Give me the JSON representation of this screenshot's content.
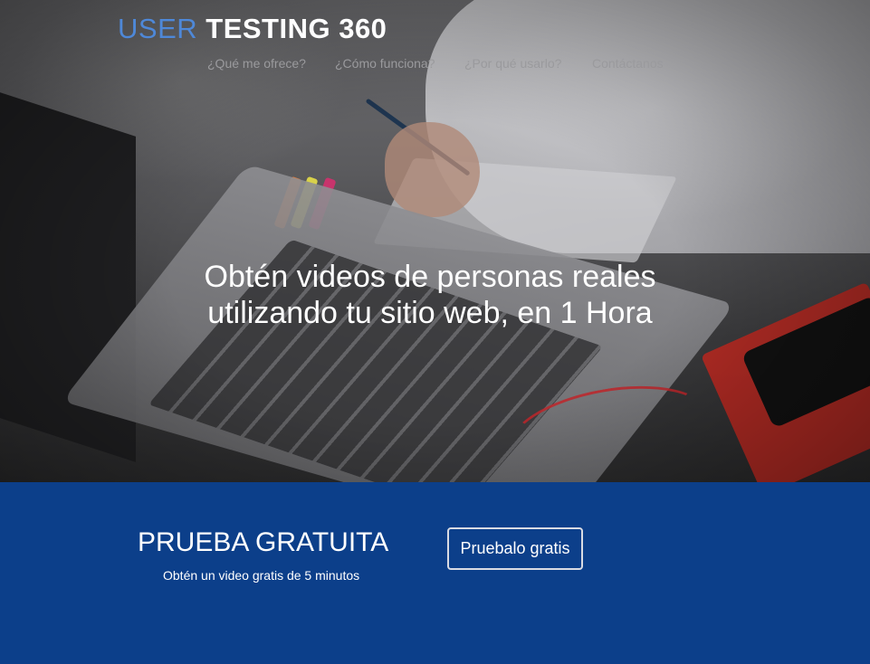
{
  "header": {
    "logo_part1": "USER",
    "logo_part2": " TESTING 360"
  },
  "nav": {
    "items": [
      {
        "label": "¿Qué me ofrece?"
      },
      {
        "label": "¿Cómo funciona?"
      },
      {
        "label": "¿Por qué usarlo?"
      },
      {
        "label": "Contáctanos"
      }
    ]
  },
  "hero": {
    "headline_line1": "Obtén videos de personas reales",
    "headline_line2": "utilizando tu sitio web, en 1 Hora"
  },
  "cta": {
    "title": "PRUEBA GRATUITA",
    "subtitle": "Obtén un video gratis de 5 minutos",
    "button_label": "Pruebalo gratis"
  },
  "colors": {
    "cta_background": "#0c3f8a",
    "logo_accent": "#4e88d8",
    "nav_text": "#9a9a9d"
  }
}
